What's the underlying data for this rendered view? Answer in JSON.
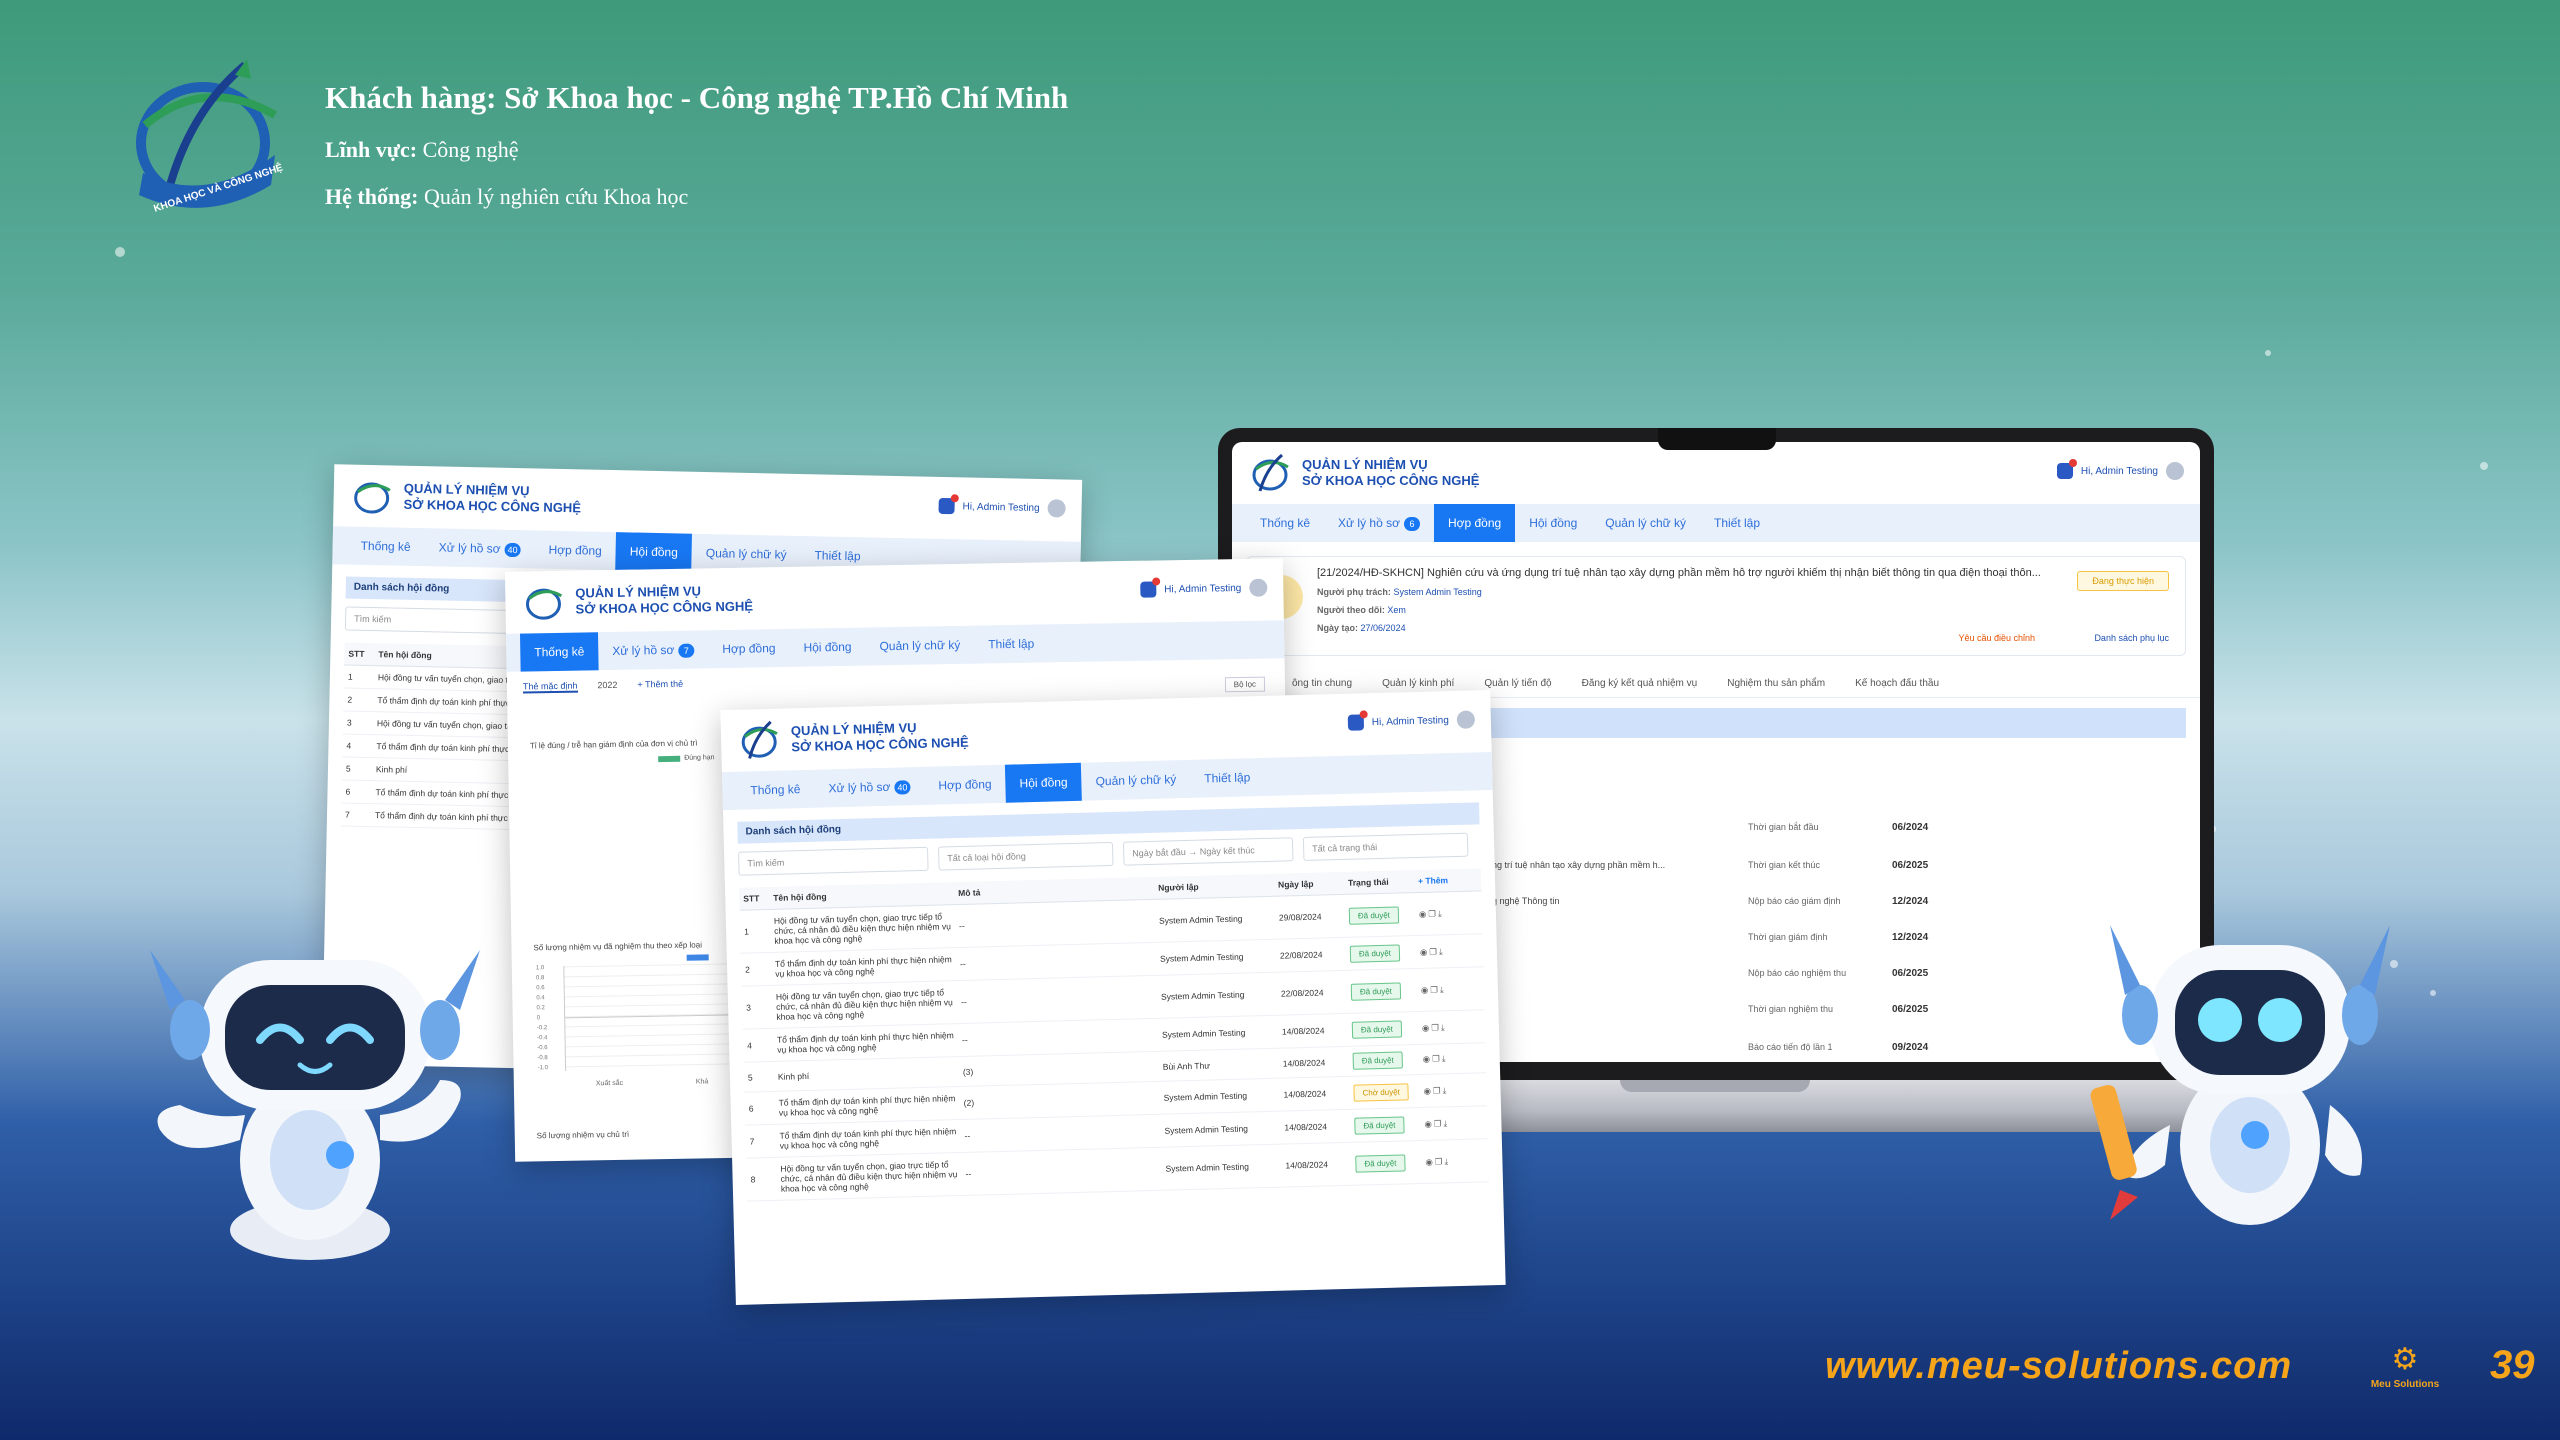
{
  "header": {
    "client_label": "Khách hàng:",
    "client_value": "Sở Khoa học - Công nghệ TP.Hồ Chí Minh",
    "field_label": "Lĩnh vực:",
    "field_value": "Công nghệ",
    "system_label": "Hệ thống:",
    "system_value": "Quản lý nghiên cứu Khoa học",
    "logo_text": "KHOA HỌC VÀ CÔNG NGHỆ"
  },
  "footer": {
    "website": "www.meu-solutions.com",
    "brand": "Meu Solutions",
    "page_number": "39"
  },
  "app": {
    "name_line1": "QUẢN LÝ NHIỆM VỤ",
    "name_line2": "SỞ KHOA HỌC CÔNG NGHỆ",
    "user": "Hi, Admin Testing",
    "nav": {
      "stats": "Thống kê",
      "records": "Xử lý hồ sơ",
      "contracts": "Hợp đồng",
      "council": "Hội đồng",
      "signature": "Quản lý chữ ký",
      "setup": "Thiết lập"
    },
    "record_badge_laptop": "6",
    "record_badge_win": "40",
    "record_badge_win2": "7"
  },
  "laptop": {
    "title": "[21/2024/HĐ-SKHCN] Nghiên cứu và ứng dụng trí tuệ nhân tạo xây dựng phần mềm hỗ trợ người khiếm thị nhận biết thông tin qua điện thoại thôn...",
    "owner_label": "Người phụ trách:",
    "owner_value": "System Admin Testing",
    "follower_label": "Người theo dõi:",
    "follower_value": "Xem",
    "created_label": "Ngày tạo:",
    "created_value": "27/06/2024",
    "status": "Đang thực hiện",
    "request_edit": "Yêu cầu điều chỉnh",
    "appendix": "Danh sách phụ lục",
    "subtabs": [
      "ông tin chung",
      "Quản lý kinh phí",
      "Quản lý tiến độ",
      "Đăng ký kết quả nhiệm vụ",
      "Nghiệm thu sản phẩm",
      "Kế hoạch đấu thầu"
    ],
    "fragments": [
      "dụng trí tuệ nhân tạo xây dựng phần mềm h...",
      "ông nghệ Thông tin",
      "N"
    ],
    "schedule": [
      {
        "label": "Thời gian bắt đầu",
        "value": "06/2024"
      },
      {
        "label": "Thời gian kết thúc",
        "value": "06/2025"
      },
      {
        "label": "Nộp báo cáo giám định",
        "value": "12/2024"
      },
      {
        "label": "Thời gian giám định",
        "value": "12/2024"
      },
      {
        "label": "Nộp báo cáo nghiệm thu",
        "value": "06/2025"
      },
      {
        "label": "Thời gian nghiệm thu",
        "value": "06/2025"
      },
      {
        "label": "Báo cáo tiến độ lần 1",
        "value": "09/2024"
      }
    ]
  },
  "win2": {
    "tabs": [
      "Thẻ mặc định",
      "2022",
      "+ Thêm thẻ"
    ],
    "chart1_title": "Tỉ lệ đúng / trễ hạn giám định của đơn vị chủ trì",
    "chart1_legend": "Đúng hạn",
    "chart2_title": "Số lượng nhiệm vụ đã nghiệm thu theo xếp loại",
    "chart2_yticks": [
      "1.0",
      "0.8",
      "0.6",
      "0.4",
      "0.2",
      "0",
      "-0.2",
      "-0.4",
      "-0.6",
      "-0.8",
      "-1.0"
    ],
    "chart2_xticks": [
      "Xuất sắc",
      "Khá"
    ],
    "chart3_title": "Số lượng nhiệm vụ chủ trì",
    "filter_btn": "Bộ lọc"
  },
  "list": {
    "title": "Danh sách hội đồng",
    "search_placeholder": "Tìm kiếm",
    "filter_type": "Tất cả loại hội đồng",
    "filter_date": "Ngày bắt đầu → Ngày kết thúc",
    "filter_status": "Tất cả trạng thái",
    "columns": [
      "STT",
      "Tên hội đồng",
      "Mô tả",
      "Người lập",
      "Ngày lập",
      "Trạng thái",
      "+ Thêm"
    ],
    "rows": [
      {
        "stt": "1",
        "name": "Hội đồng tư vấn tuyển chọn, giao trực tiếp tổ chức, cá nhân đủ điều kiện thực hiện nhiệm vụ khoa học và công nghệ",
        "desc": "--",
        "creator": "System Admin Testing",
        "date": "29/08/2024",
        "status": "Đã duyệt"
      },
      {
        "stt": "2",
        "name": "Tổ thẩm định dự toán kinh phí thực hiện nhiệm vụ khoa học và công nghệ",
        "desc": "--",
        "creator": "System Admin Testing",
        "date": "22/08/2024",
        "status": "Đã duyệt"
      },
      {
        "stt": "3",
        "name": "Hội đồng tư vấn tuyển chọn, giao trực tiếp tổ chức, cá nhân đủ điều kiện thực hiện nhiệm vụ khoa học và công nghệ",
        "desc": "--",
        "creator": "System Admin Testing",
        "date": "22/08/2024",
        "status": "Đã duyệt"
      },
      {
        "stt": "4",
        "name": "Tổ thẩm định dự toán kinh phí thực hiện nhiệm vụ khoa học và công nghệ",
        "desc": "--",
        "creator": "System Admin Testing",
        "date": "14/08/2024",
        "status": "Đã duyệt"
      },
      {
        "stt": "5",
        "name": "Kinh phí",
        "desc": "(3)",
        "creator": "Bùi Anh Thư",
        "date": "14/08/2024",
        "status": "Đã duyệt"
      },
      {
        "stt": "6",
        "name": "Tổ thẩm định dự toán kinh phí thực hiện nhiệm vụ khoa học và công nghệ",
        "desc": "(2)",
        "creator": "System Admin Testing",
        "date": "14/08/2024",
        "status": "Chờ duyệt"
      },
      {
        "stt": "7",
        "name": "Tổ thẩm định dự toán kinh phí thực hiện nhiệm vụ khoa học và công nghệ",
        "desc": "--",
        "creator": "System Admin Testing",
        "date": "14/08/2024",
        "status": "Đã duyệt"
      },
      {
        "stt": "8",
        "name": "Hội đồng tư vấn tuyển chọn, giao trực tiếp tổ chức, cá nhân đủ điều kiện thực hiện nhiệm vụ khoa học và công nghệ",
        "desc": "--",
        "creator": "System Admin Testing",
        "date": "14/08/2024",
        "status": "Đã duyệt"
      }
    ],
    "back_rows": [
      {
        "stt": "1",
        "name": "Hội đồng tư vấn tuyển chọn, giao trực tiếp tổ chức, cá nhân đủ điều kiện thực hiện nhiệm vụ khoa học và công nghệ"
      },
      {
        "stt": "2",
        "name": "Tổ thẩm định dự toán kinh phí thực hiện nhiệm vụ khoa học và công nghệ"
      },
      {
        "stt": "3",
        "name": "Hội đồng tư vấn tuyển chọn, giao trực tiếp tổ chức, cá nhân đủ điều kiện thực hiện nhiệm vụ khoa học và công nghệ"
      },
      {
        "stt": "4",
        "name": "Tổ thẩm định dự toán kinh phí thực hiện nhiệm vụ khoa học và công nghệ"
      },
      {
        "stt": "5",
        "name": "Kinh phí"
      },
      {
        "stt": "6",
        "name": "Tổ thẩm định dự toán kinh phí thực hiện nhiệm vụ khoa học và công nghệ"
      },
      {
        "stt": "7",
        "name": "Tổ thẩm định dự toán kinh phí thực hiện nhiệm vụ khoa học và công nghệ"
      }
    ]
  },
  "colors": {
    "accent": "#1877f2",
    "brand_orange": "#f6a51a",
    "title_blue": "#1d4fb1"
  }
}
